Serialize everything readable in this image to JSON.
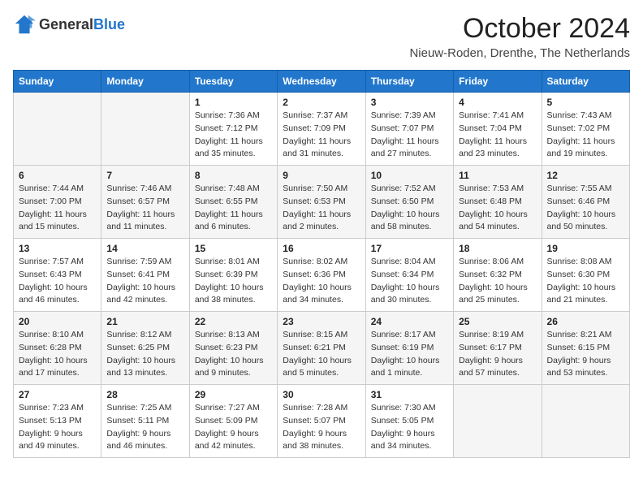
{
  "header": {
    "logo_general": "General",
    "logo_blue": "Blue",
    "month_title": "October 2024",
    "location": "Nieuw-Roden, Drenthe, The Netherlands"
  },
  "days_of_week": [
    "Sunday",
    "Monday",
    "Tuesday",
    "Wednesday",
    "Thursday",
    "Friday",
    "Saturday"
  ],
  "weeks": [
    [
      {
        "day": "",
        "info": ""
      },
      {
        "day": "",
        "info": ""
      },
      {
        "day": "1",
        "info": "Sunrise: 7:36 AM\nSunset: 7:12 PM\nDaylight: 11 hours and 35 minutes."
      },
      {
        "day": "2",
        "info": "Sunrise: 7:37 AM\nSunset: 7:09 PM\nDaylight: 11 hours and 31 minutes."
      },
      {
        "day": "3",
        "info": "Sunrise: 7:39 AM\nSunset: 7:07 PM\nDaylight: 11 hours and 27 minutes."
      },
      {
        "day": "4",
        "info": "Sunrise: 7:41 AM\nSunset: 7:04 PM\nDaylight: 11 hours and 23 minutes."
      },
      {
        "day": "5",
        "info": "Sunrise: 7:43 AM\nSunset: 7:02 PM\nDaylight: 11 hours and 19 minutes."
      }
    ],
    [
      {
        "day": "6",
        "info": "Sunrise: 7:44 AM\nSunset: 7:00 PM\nDaylight: 11 hours and 15 minutes."
      },
      {
        "day": "7",
        "info": "Sunrise: 7:46 AM\nSunset: 6:57 PM\nDaylight: 11 hours and 11 minutes."
      },
      {
        "day": "8",
        "info": "Sunrise: 7:48 AM\nSunset: 6:55 PM\nDaylight: 11 hours and 6 minutes."
      },
      {
        "day": "9",
        "info": "Sunrise: 7:50 AM\nSunset: 6:53 PM\nDaylight: 11 hours and 2 minutes."
      },
      {
        "day": "10",
        "info": "Sunrise: 7:52 AM\nSunset: 6:50 PM\nDaylight: 10 hours and 58 minutes."
      },
      {
        "day": "11",
        "info": "Sunrise: 7:53 AM\nSunset: 6:48 PM\nDaylight: 10 hours and 54 minutes."
      },
      {
        "day": "12",
        "info": "Sunrise: 7:55 AM\nSunset: 6:46 PM\nDaylight: 10 hours and 50 minutes."
      }
    ],
    [
      {
        "day": "13",
        "info": "Sunrise: 7:57 AM\nSunset: 6:43 PM\nDaylight: 10 hours and 46 minutes."
      },
      {
        "day": "14",
        "info": "Sunrise: 7:59 AM\nSunset: 6:41 PM\nDaylight: 10 hours and 42 minutes."
      },
      {
        "day": "15",
        "info": "Sunrise: 8:01 AM\nSunset: 6:39 PM\nDaylight: 10 hours and 38 minutes."
      },
      {
        "day": "16",
        "info": "Sunrise: 8:02 AM\nSunset: 6:36 PM\nDaylight: 10 hours and 34 minutes."
      },
      {
        "day": "17",
        "info": "Sunrise: 8:04 AM\nSunset: 6:34 PM\nDaylight: 10 hours and 30 minutes."
      },
      {
        "day": "18",
        "info": "Sunrise: 8:06 AM\nSunset: 6:32 PM\nDaylight: 10 hours and 25 minutes."
      },
      {
        "day": "19",
        "info": "Sunrise: 8:08 AM\nSunset: 6:30 PM\nDaylight: 10 hours and 21 minutes."
      }
    ],
    [
      {
        "day": "20",
        "info": "Sunrise: 8:10 AM\nSunset: 6:28 PM\nDaylight: 10 hours and 17 minutes."
      },
      {
        "day": "21",
        "info": "Sunrise: 8:12 AM\nSunset: 6:25 PM\nDaylight: 10 hours and 13 minutes."
      },
      {
        "day": "22",
        "info": "Sunrise: 8:13 AM\nSunset: 6:23 PM\nDaylight: 10 hours and 9 minutes."
      },
      {
        "day": "23",
        "info": "Sunrise: 8:15 AM\nSunset: 6:21 PM\nDaylight: 10 hours and 5 minutes."
      },
      {
        "day": "24",
        "info": "Sunrise: 8:17 AM\nSunset: 6:19 PM\nDaylight: 10 hours and 1 minute."
      },
      {
        "day": "25",
        "info": "Sunrise: 8:19 AM\nSunset: 6:17 PM\nDaylight: 9 hours and 57 minutes."
      },
      {
        "day": "26",
        "info": "Sunrise: 8:21 AM\nSunset: 6:15 PM\nDaylight: 9 hours and 53 minutes."
      }
    ],
    [
      {
        "day": "27",
        "info": "Sunrise: 7:23 AM\nSunset: 5:13 PM\nDaylight: 9 hours and 49 minutes."
      },
      {
        "day": "28",
        "info": "Sunrise: 7:25 AM\nSunset: 5:11 PM\nDaylight: 9 hours and 46 minutes."
      },
      {
        "day": "29",
        "info": "Sunrise: 7:27 AM\nSunset: 5:09 PM\nDaylight: 9 hours and 42 minutes."
      },
      {
        "day": "30",
        "info": "Sunrise: 7:28 AM\nSunset: 5:07 PM\nDaylight: 9 hours and 38 minutes."
      },
      {
        "day": "31",
        "info": "Sunrise: 7:30 AM\nSunset: 5:05 PM\nDaylight: 9 hours and 34 minutes."
      },
      {
        "day": "",
        "info": ""
      },
      {
        "day": "",
        "info": ""
      }
    ]
  ]
}
